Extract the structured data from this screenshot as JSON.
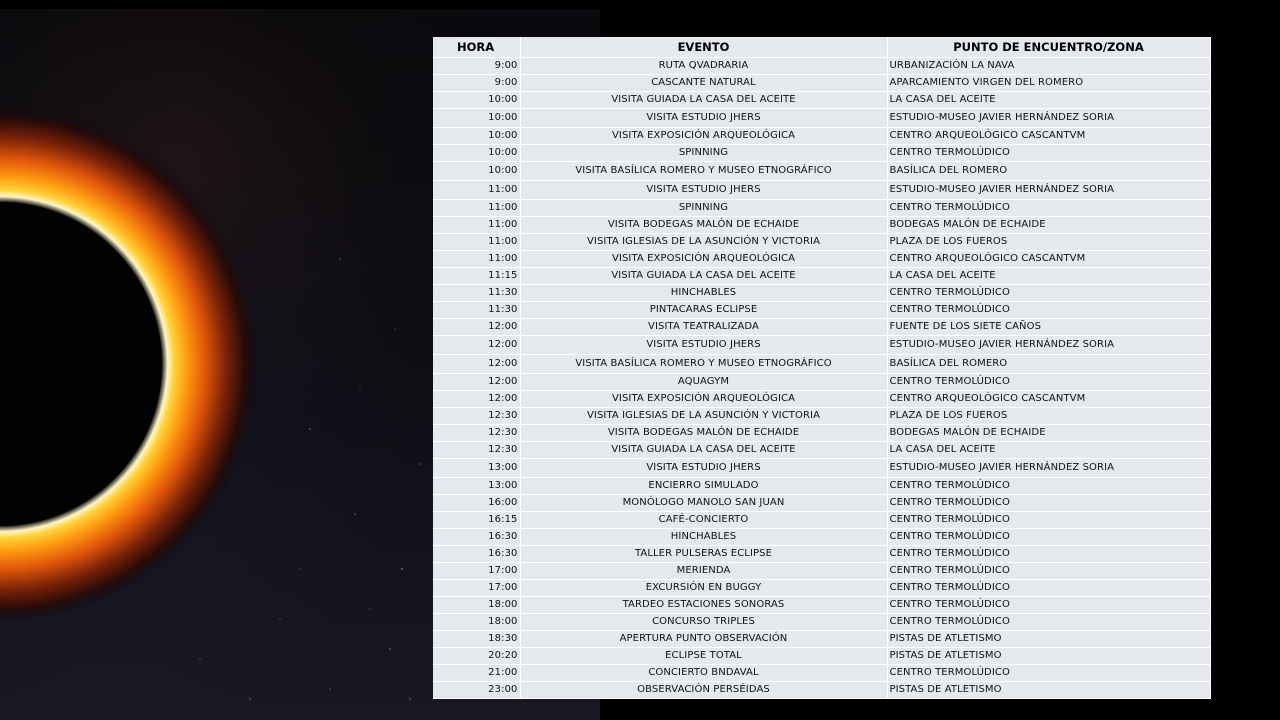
{
  "table": {
    "headers": {
      "hora": "HORA",
      "evento": "EVENTO",
      "punto": "PUNTO DE ENCUENTRO/ZONA"
    },
    "rows": [
      {
        "hora": "9:00",
        "evento": "RUTA QVADRARIA",
        "punto": "URBANIZACIÓN LA NAVA"
      },
      {
        "hora": "9:00",
        "evento": "CASCANTE NATURAL",
        "punto": "APARCAMIENTO VIRGEN DEL ROMERO"
      },
      {
        "hora": "10:00",
        "evento": "VISITA GUIADA LA CASA DEL ACEITE",
        "punto": "LA CASA DEL ACEITE"
      },
      {
        "hora": "10:00",
        "evento": "VISITA ESTUDIO JHERS",
        "punto": "ESTUDIO-MUSEO JAVIER HERNÁNDEZ SORIA"
      },
      {
        "hora": "10:00",
        "evento": "VISITA EXPOSICIÓN ARQUEOLÓGICA",
        "punto": "CENTRO ARQUEOLÓGICO CASCANTVM"
      },
      {
        "hora": "10:00",
        "evento": "SPINNING",
        "punto": "CENTRO TERMOLÚDICO"
      },
      {
        "hora": "10:00",
        "evento": "VISITA BASÍLICA ROMERO Y MUSEO ETNOGRÁFICO",
        "punto": "BASÍLICA DEL ROMERO"
      },
      {
        "hora": "11:00",
        "evento": "VISITA ESTUDIO JHERS",
        "punto": "ESTUDIO-MUSEO JAVIER HERNÁNDEZ SORIA"
      },
      {
        "hora": "11:00",
        "evento": "SPINNING",
        "punto": "CENTRO TERMOLÚDICO"
      },
      {
        "hora": "11:00",
        "evento": "VISITA BODEGAS MALÓN DE ECHAIDE",
        "punto": "BODEGAS MALÓN DE ECHAIDE"
      },
      {
        "hora": "11:00",
        "evento": "VISITA IGLESIAS DE LA ASUNCIÓN Y VICTORIA",
        "punto": "PLAZA DE LOS FUEROS"
      },
      {
        "hora": "11:00",
        "evento": "VISITA EXPOSICIÓN ARQUEOLÓGICA",
        "punto": "CENTRO ARQUEOLÓGICO CASCANTVM"
      },
      {
        "hora": "11:15",
        "evento": "VISITA GUIADA LA CASA DEL ACEITE",
        "punto": "LA CASA DEL ACEITE"
      },
      {
        "hora": "11:30",
        "evento": "HINCHABLES",
        "punto": "CENTRO TERMOLÚDICO"
      },
      {
        "hora": "11:30",
        "evento": "PINTACARAS ECLIPSE",
        "punto": "CENTRO TERMOLÚDICO"
      },
      {
        "hora": "12:00",
        "evento": "VISITA TEATRALIZADA",
        "punto": "FUENTE DE LOS SIETE CAÑOS"
      },
      {
        "hora": "12:00",
        "evento": "VISITA ESTUDIO JHERS",
        "punto": "ESTUDIO-MUSEO JAVIER HERNÁNDEZ SORIA"
      },
      {
        "hora": "12:00",
        "evento": "VISITA BASÍLICA ROMERO Y MUSEO ETNOGRÁFICO",
        "punto": "BASÍLICA DEL ROMERO"
      },
      {
        "hora": "12:00",
        "evento": "AQUAGYM",
        "punto": "CENTRO TERMOLÚDICO"
      },
      {
        "hora": "12:00",
        "evento": "VISITA EXPOSICIÓN ARQUEOLÓGICA",
        "punto": "CENTRO ARQUEOLÓGICO CASCANTVM"
      },
      {
        "hora": "12:30",
        "evento": "VISITA IGLESIAS DE LA ASUNCIÓN Y VICTORIA",
        "punto": "PLAZA DE LOS FUEROS"
      },
      {
        "hora": "12:30",
        "evento": "VISITA BODEGAS MALÓN DE ECHAIDE",
        "punto": "BODEGAS MALÓN DE ECHAIDE"
      },
      {
        "hora": "12:30",
        "evento": "VISITA GUIADA LA CASA DEL ACEITE",
        "punto": "LA CASA DEL ACEITE"
      },
      {
        "hora": "13:00",
        "evento": "VISITA ESTUDIO JHERS",
        "punto": "ESTUDIO-MUSEO JAVIER HERNÁNDEZ SORIA"
      },
      {
        "hora": "13:00",
        "evento": "ENCIERRO SIMULADO",
        "punto": "CENTRO TERMOLÚDICO"
      },
      {
        "hora": "16:00",
        "evento": "MONÓLOGO MANOLO SAN JUAN",
        "punto": "CENTRO TERMOLÚDICO"
      },
      {
        "hora": "16:15",
        "evento": "CAFÉ-CONCIERTO",
        "punto": "CENTRO TERMOLÚDICO"
      },
      {
        "hora": "16:30",
        "evento": "HINCHABLES",
        "punto": "CENTRO TERMOLÚDICO"
      },
      {
        "hora": "16:30",
        "evento": "TALLER PULSERAS ECLIPSE",
        "punto": "CENTRO TERMOLÚDICO"
      },
      {
        "hora": "17:00",
        "evento": "MERIENDA",
        "punto": "CENTRO TERMOLÚDICO"
      },
      {
        "hora": "17:00",
        "evento": "EXCURSIÓN EN BUGGY",
        "punto": "CENTRO TERMOLÚDICO"
      },
      {
        "hora": "18:00",
        "evento": "TARDEO ESTACIONES SONORAS",
        "punto": "CENTRO TERMOLÚDICO"
      },
      {
        "hora": "18:00",
        "evento": "CONCURSO TRIPLES",
        "punto": "CENTRO TERMOLÚDICO"
      },
      {
        "hora": "18:30",
        "evento": "APERTURA PUNTO OBSERVACIÓN",
        "punto": "PISTAS DE ATLETISMO"
      },
      {
        "hora": "20:20",
        "evento": "ECLIPSE TOTAL",
        "punto": "PISTAS DE ATLETISMO"
      },
      {
        "hora": "21:00",
        "evento": "CONCIERTO BNDAVAL",
        "punto": "CENTRO TERMOLÚDICO"
      },
      {
        "hora": "23:00",
        "evento": "OBSERVACIÓN PERSÉIDAS",
        "punto": "PISTAS DE ATLETISMO"
      }
    ]
  }
}
